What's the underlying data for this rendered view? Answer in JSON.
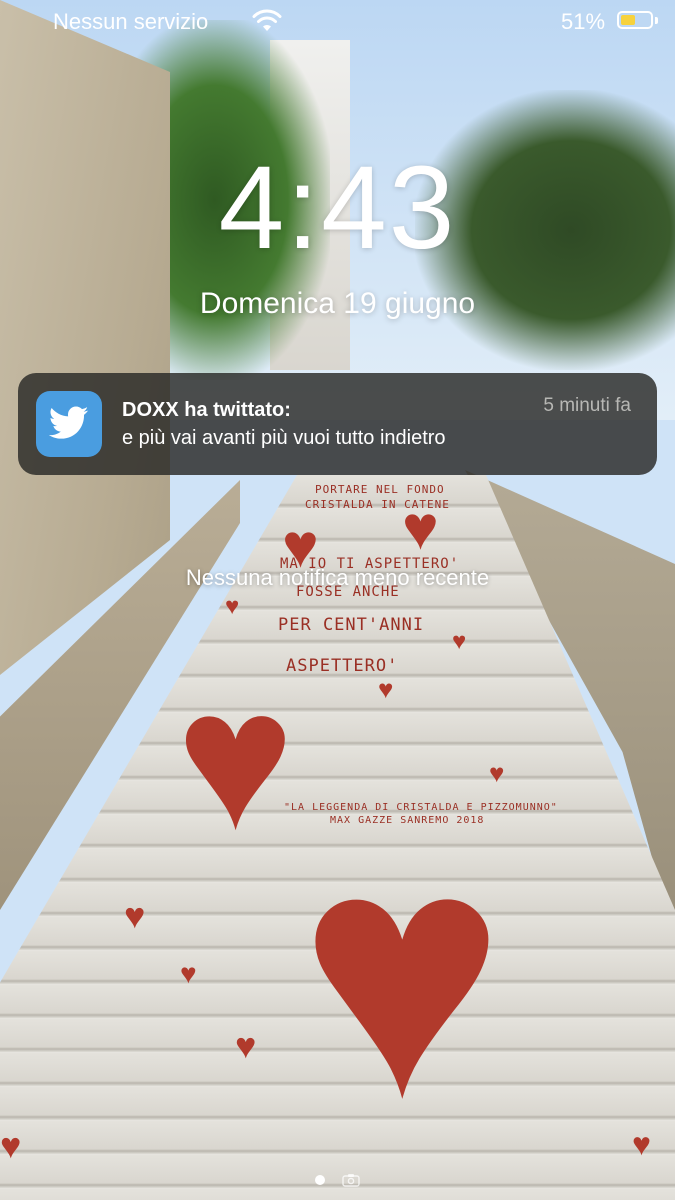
{
  "status_bar": {
    "carrier": "Nessun servizio",
    "battery_percent": "51%",
    "battery_level": 0.51,
    "battery_color": "#f7d23c",
    "wifi_icon": "wifi-icon"
  },
  "lock_screen": {
    "time": "4:43",
    "date": "Domenica 19 giugno"
  },
  "notification": {
    "app_icon": "twitter-bird-icon",
    "app_color": "#4a9de0",
    "title": "DOXX ha twittato:",
    "body": "e più vai avanti più vuoi tutto indietro",
    "time": "5 minuti fa"
  },
  "no_older_notifications": "Nessuna notifica meno recente",
  "wallpaper_text": {
    "line1": "PORTARE NEL FONDO",
    "line2": "CRISTALDA IN CATENE",
    "line3": "MA IO TI ASPETTERO'",
    "line4": "FOSSE ANCHE",
    "line5": "PER CENT'ANNI",
    "line6": "ASPETTERO'",
    "credit1": "\"LA LEGGENDA DI CRISTALDA E PIZZOMUNNO\"",
    "credit2": "MAX GAZZE  SANREMO 2018"
  },
  "page_indicator": {
    "active_page": 1,
    "camera_icon": "camera-icon"
  }
}
